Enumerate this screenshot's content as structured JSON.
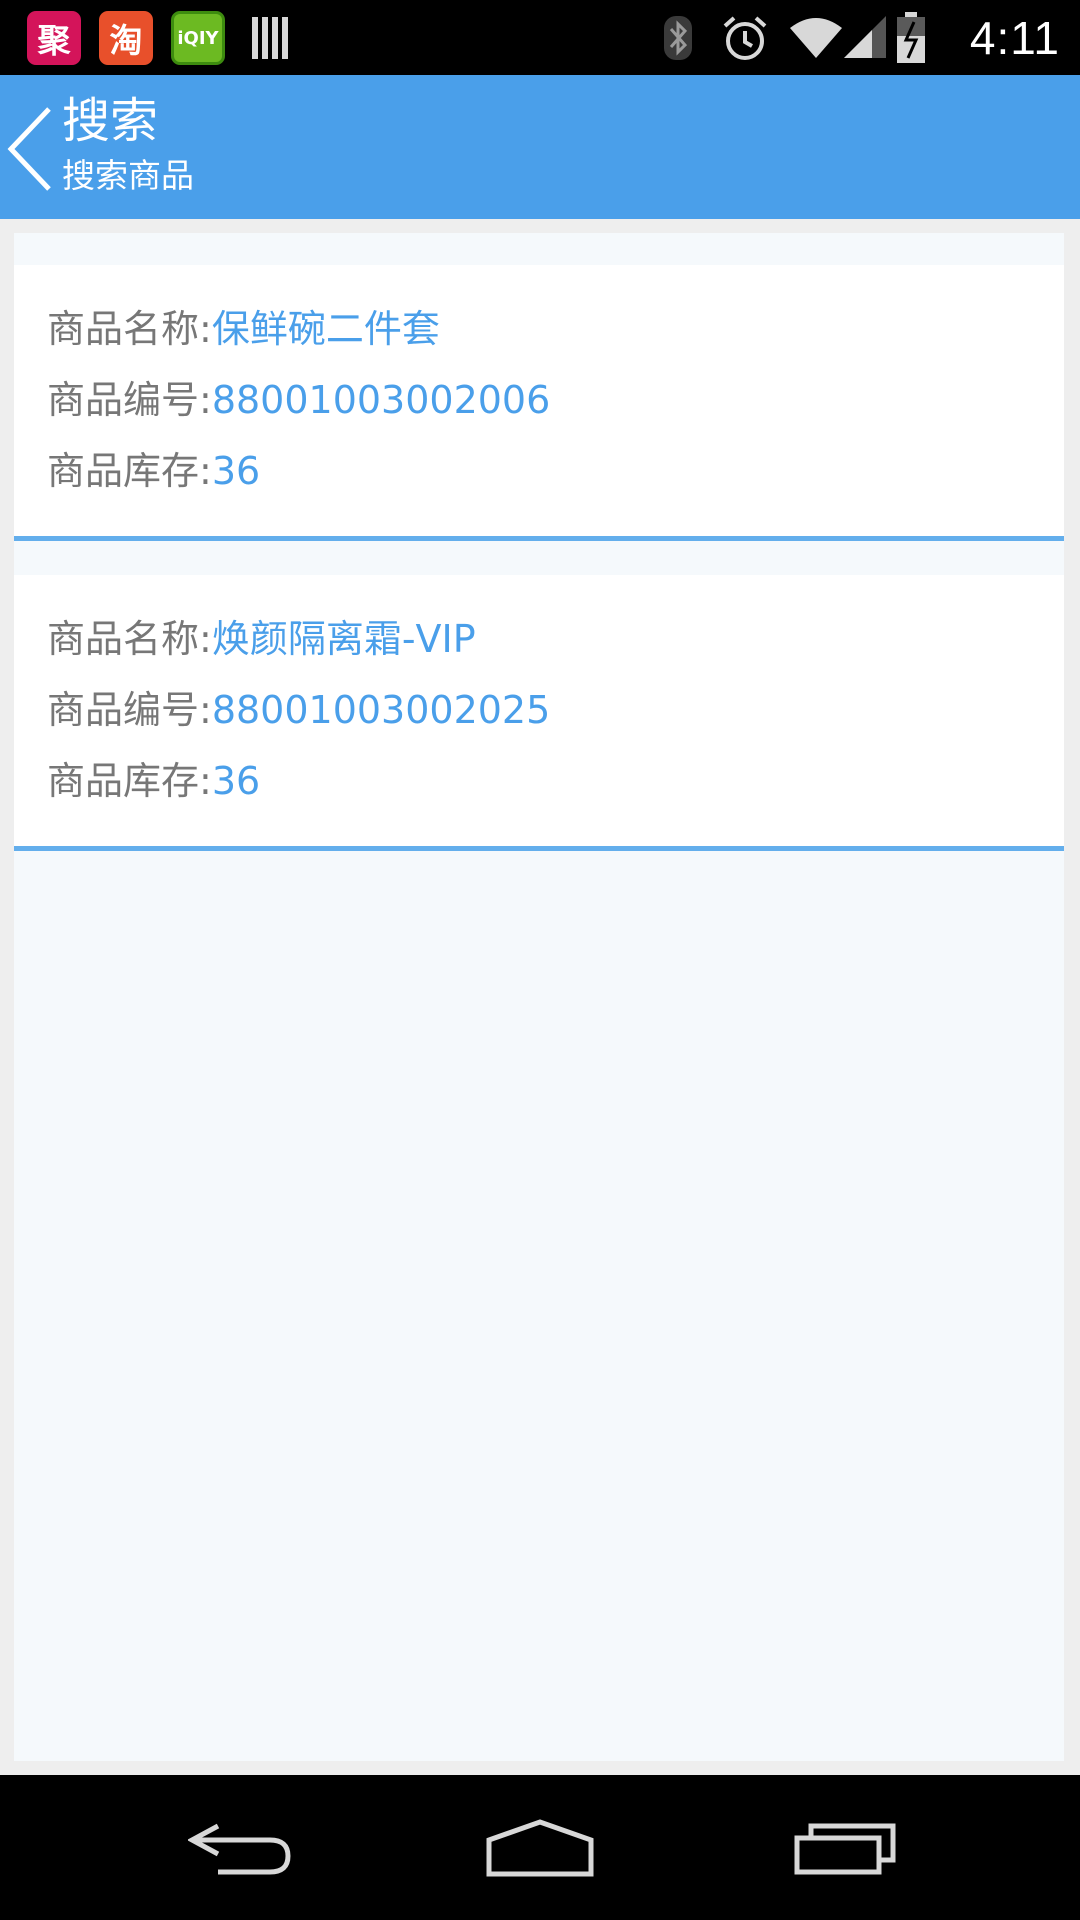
{
  "status_bar": {
    "notifications": [
      {
        "icon": "ju-app-icon",
        "glyph": "聚"
      },
      {
        "icon": "taobao-app-icon",
        "glyph": "淘"
      },
      {
        "icon": "iqiyi-app-icon",
        "glyph": "iQIY"
      },
      {
        "icon": "barcode-app-icon",
        "glyph": ""
      }
    ],
    "status_icons": [
      "bluetooth-icon",
      "alarm-icon",
      "wifi-icon",
      "signal-icon",
      "battery-icon"
    ],
    "time": "4:11"
  },
  "action_bar": {
    "title": "搜索",
    "subtitle": "搜索商品",
    "back_icon": "chevron-left-icon"
  },
  "results": [
    {
      "name_label": "商品名称:",
      "name": "保鲜碗二件套",
      "code_label": "商品编号:",
      "code": "88001003002006",
      "stock_label": "商品库存:",
      "stock": "36"
    },
    {
      "name_label": "商品名称:",
      "name": "焕颜隔离霜-VIP",
      "code_label": "商品编号:",
      "code": "88001003002025",
      "stock_label": "商品库存:",
      "stock": "36"
    }
  ],
  "nav_bar": {
    "buttons": [
      "back-icon",
      "home-icon",
      "recent-apps-icon"
    ]
  },
  "colors": {
    "accent": "#4a9fea",
    "divider": "#63aeec",
    "label_text": "#777777"
  }
}
